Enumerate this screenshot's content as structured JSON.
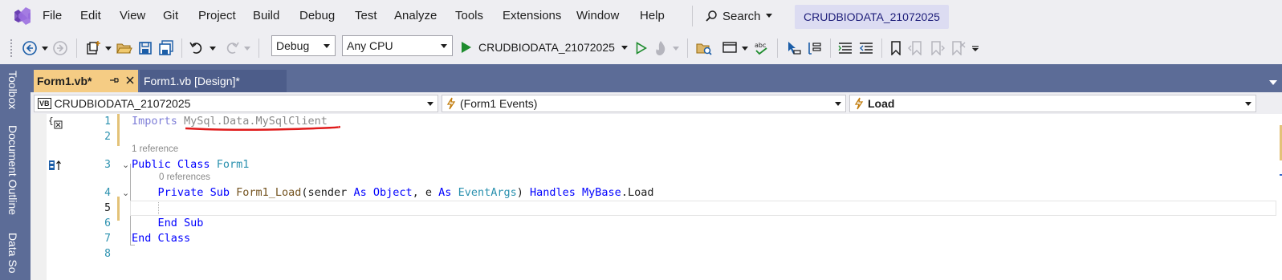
{
  "menubar": {
    "items": [
      "File",
      "Edit",
      "View",
      "Git",
      "Project",
      "Build",
      "Debug",
      "Test",
      "Analyze",
      "Tools",
      "Extensions",
      "Window",
      "Help"
    ],
    "search_label": "Search",
    "solution_title": "CRUDBIODATA_21072025"
  },
  "toolbar": {
    "configuration": "Debug",
    "platform": "Any CPU",
    "run_target": "CRUDBIODATA_21072025"
  },
  "side_tabs": [
    "Toolbox",
    "Document Outline",
    "Data So"
  ],
  "doc_tabs": {
    "active": "Form1.vb*",
    "inactive": "Form1.vb [Design]*"
  },
  "nav_bar": {
    "project": "CRUDBIODATA_21072025",
    "project_badge": "VB",
    "object": "(Form1 Events)",
    "member": "Load"
  },
  "editor": {
    "line_numbers": [
      "1",
      "2",
      "3",
      "4",
      "5",
      "6",
      "7",
      "8"
    ],
    "lens_1": "1 reference",
    "lens_2": "0 references",
    "line1": {
      "kw": "Imports",
      "ns": "MySql.Data.MySqlClient"
    },
    "line3": {
      "kw1": "Public",
      "kw2": "Class",
      "name": "Form1"
    },
    "line4": {
      "kw1": "Private",
      "kw2": "Sub",
      "name": "Form1_Load",
      "p1": "sender",
      "as1": "As",
      "t1": "Object",
      "p2": "e",
      "as2": "As",
      "t2": "EventArgs",
      "handles": "Handles",
      "mybase": "MyBase",
      "event": ".Load"
    },
    "line6": {
      "kw1": "End",
      "kw2": "Sub"
    },
    "line7": {
      "kw1": "End",
      "kw2": "Class"
    }
  }
}
